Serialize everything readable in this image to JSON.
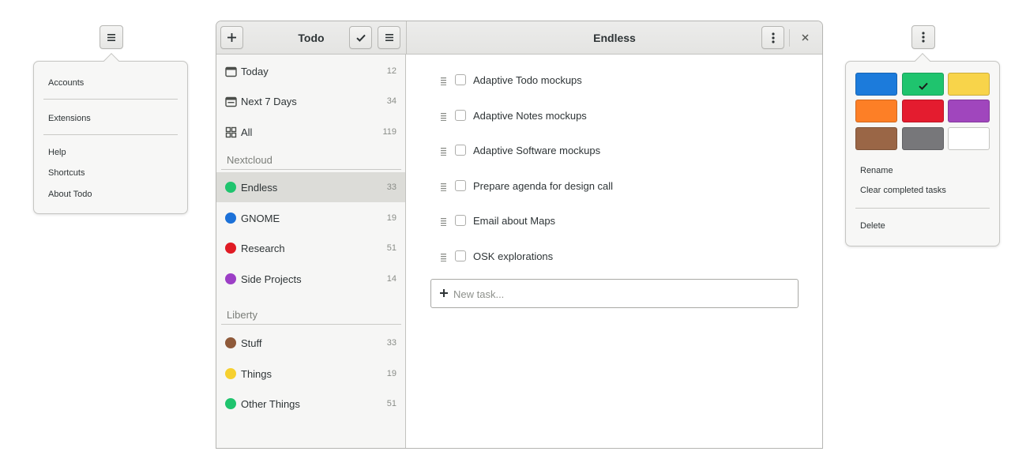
{
  "app_menu": {
    "items": [
      {
        "label": "Accounts"
      },
      {
        "label": "Extensions"
      },
      {
        "label": "Help"
      },
      {
        "label": "Shortcuts"
      },
      {
        "label": "About Todo"
      }
    ]
  },
  "header": {
    "sidebar_title": "Todo",
    "list_title": "Endless",
    "icons": {
      "add": "plus-icon",
      "select": "checkmark-icon",
      "menu": "hamburger-icon",
      "options": "vertical-dots-icon",
      "close": "close-icon"
    }
  },
  "sidebar": {
    "smart_lists": [
      {
        "label": "Today",
        "count": "12",
        "icon": "calendar-day-icon"
      },
      {
        "label": "Next 7 Days",
        "count": "34",
        "icon": "calendar-week-icon"
      },
      {
        "label": "All",
        "count": "119",
        "icon": "grid-icon"
      }
    ],
    "sections": [
      {
        "title": "Nextcloud",
        "lists": [
          {
            "label": "Endless",
            "count": "33",
            "color": "#1fc46e",
            "selected": true
          },
          {
            "label": "GNOME",
            "count": "19",
            "color": "#1c71d8"
          },
          {
            "label": "Research",
            "count": "51",
            "color": "#e01b24"
          },
          {
            "label": "Side Projects",
            "count": "14",
            "color": "#9c3fc6"
          }
        ]
      },
      {
        "title": "Liberty",
        "lists": [
          {
            "label": "Stuff",
            "count": "33",
            "color": "#8f5a3a"
          },
          {
            "label": "Things",
            "count": "19",
            "color": "#f6d02f"
          },
          {
            "label": "Other Things",
            "count": "51",
            "color": "#1fc46e"
          }
        ]
      }
    ]
  },
  "tasks": [
    {
      "label": "Adaptive Todo mockups",
      "done": false
    },
    {
      "label": "Adaptive Notes mockups",
      "done": false
    },
    {
      "label": "Adaptive Software mockups",
      "done": false
    },
    {
      "label": "Prepare agenda for design call",
      "done": false
    },
    {
      "label": "Email about Maps",
      "done": false
    },
    {
      "label": "OSK explorations",
      "done": false
    }
  ],
  "new_task": {
    "placeholder": "New task...",
    "value": ""
  },
  "list_options": {
    "colors": [
      {
        "name": "blue",
        "hex": "#1c7bdb",
        "selected": false
      },
      {
        "name": "green",
        "hex": "#1fc46e",
        "selected": true
      },
      {
        "name": "yellow",
        "hex": "#f8d44a",
        "selected": false
      },
      {
        "name": "orange",
        "hex": "#fd7f26",
        "selected": false
      },
      {
        "name": "red",
        "hex": "#e41c2f",
        "selected": false
      },
      {
        "name": "purple",
        "hex": "#a046bd",
        "selected": false
      },
      {
        "name": "brown",
        "hex": "#9a6646",
        "selected": false
      },
      {
        "name": "gray",
        "hex": "#77777a",
        "selected": false
      },
      {
        "name": "white",
        "hex": "#ffffff",
        "selected": false
      }
    ],
    "items": [
      {
        "label": "Rename"
      },
      {
        "label": "Clear completed tasks"
      },
      {
        "label": "Delete"
      }
    ]
  }
}
